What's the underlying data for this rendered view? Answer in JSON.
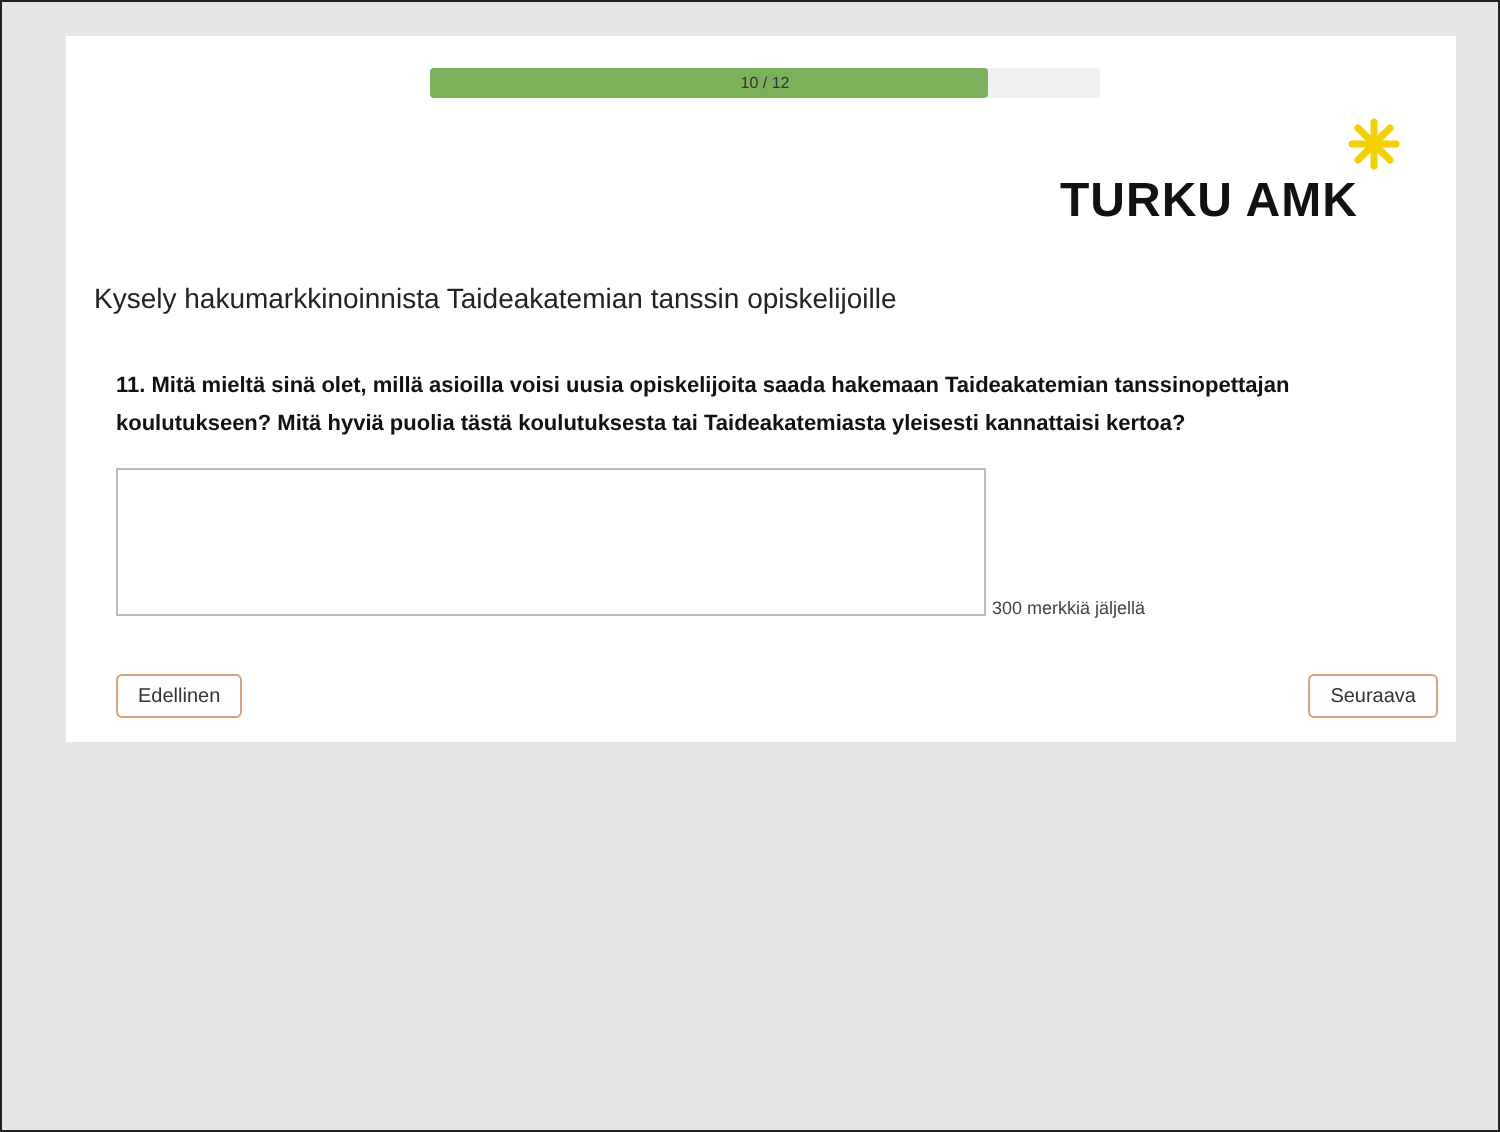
{
  "progress": {
    "label": "10 / 12",
    "level": 0.833
  },
  "logo": {
    "text": "TURKU AMK"
  },
  "survey_title": "Kysely hakumarkkinoinnista Taideakatemian tanssin opiskelijoille",
  "question": {
    "text": "11. Mitä mieltä sinä olet, millä asioilla voisi uusia opiskelijoita saada hakemaan Taideakatemian tanssinopettajan koulutukseen? Mitä hyviä puolia tästä koulutuksesta tai Taideakatemiasta yleisesti kannattaisi kertoa?",
    "counter": "300 merkkiä jäljellä"
  },
  "buttons": {
    "previous": "Edellinen",
    "next": "Seuraava"
  }
}
